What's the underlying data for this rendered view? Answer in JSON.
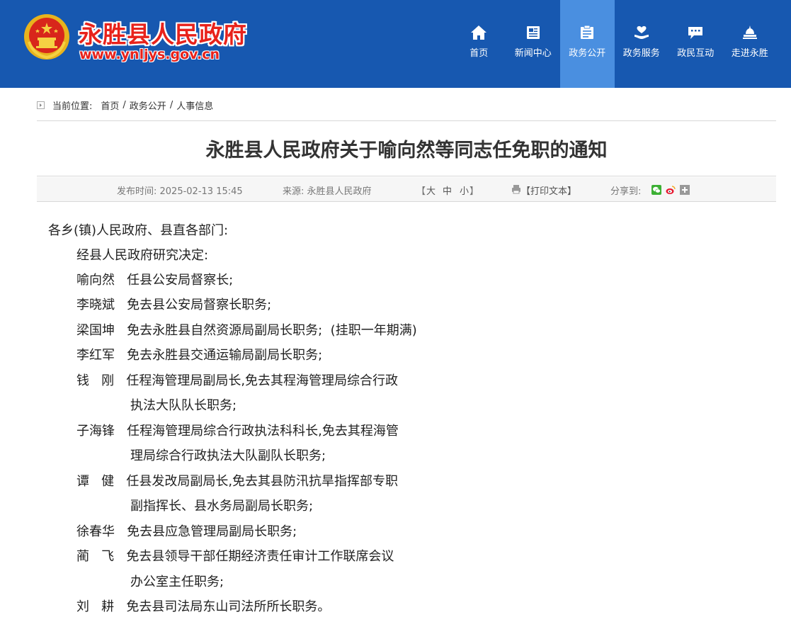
{
  "site": {
    "name": "永胜县人民政府",
    "url": "www.ynljys.gov.cn",
    "emblem": "national-emblem"
  },
  "nav": [
    {
      "label": "首页",
      "icon": "home-icon",
      "active": false
    },
    {
      "label": "新闻中心",
      "icon": "news-icon",
      "active": false
    },
    {
      "label": "政务公开",
      "icon": "gov-info-icon",
      "active": true
    },
    {
      "label": "政务服务",
      "icon": "service-icon",
      "active": false
    },
    {
      "label": "政民互动",
      "icon": "chat-icon",
      "active": false
    },
    {
      "label": "走进永胜",
      "icon": "landmark-icon",
      "active": false
    }
  ],
  "breadcrumb": {
    "lead": "当前位置:",
    "items": [
      "首页",
      "政务公开",
      "人事信息"
    ],
    "separator": "/"
  },
  "article": {
    "title": "永胜县人民政府关于喻向然等同志任免职的通知",
    "meta": {
      "publish": "发布时间: 2025-02-13 15:45",
      "source": "来源: 永胜县人民政府",
      "font_open": "【",
      "font_large": "大",
      "font_medium": "中",
      "font_small": "小",
      "font_close": "】",
      "print": "【打印文本】",
      "share": "分享到:"
    },
    "body": [
      "各乡(镇)人民政府、县直各部门:",
      "经县人民政府研究决定:",
      "喻向然   任县公安局督察长;",
      "李晓斌   免去县公安局督察长职务;",
      "梁国坤   免去永胜县自然资源局副局长职务;  (挂职一年期满)",
      "李红军   免去永胜县交通运输局副局长职务;",
      "钱   刚   任程海管理局副局长,免去其程海管理局综合行政",
      "执法大队队长职务;",
      "子海锋   任程海管理局综合行政执法科科长,免去其程海管",
      "理局综合行政执法大队副队长职务;",
      "谭   健   任县发改局副局长,免去其县防汛抗旱指挥部专职",
      "副指挥长、县水务局副局长职务;",
      "徐春华   免去县应急管理局副局长职务;",
      "蔺   飞   免去县领导干部任期经济责任审计工作联席会议",
      "办公室主任职务;",
      "刘   耕   免去县司法局东山司法所所长职务。"
    ]
  },
  "colors": {
    "header_bg": "#1758b0",
    "nav_active_bg": "#4a8fe0",
    "site_name": "#e8221b"
  }
}
